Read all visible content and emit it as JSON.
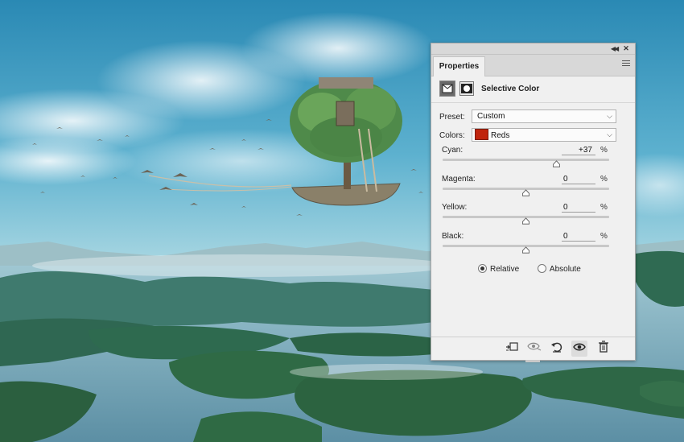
{
  "panel": {
    "tab_label": "Properties",
    "collapse_icon": "double-chevron-icon",
    "close_icon": "close-icon",
    "menu_icon": "hamburger-menu-icon",
    "adjustment_title": "Selective Color",
    "preset": {
      "label": "Preset:",
      "value": "Custom"
    },
    "colors": {
      "label": "Colors:",
      "value": "Reds",
      "swatch_color": "#c0240d"
    },
    "sliders": [
      {
        "label": "Cyan:",
        "value": "+37",
        "unit": "%",
        "level": 37
      },
      {
        "label": "Magenta:",
        "value": "0",
        "unit": "%",
        "level": 0
      },
      {
        "label": "Yellow:",
        "value": "0",
        "unit": "%",
        "level": 0
      },
      {
        "label": "Black:",
        "value": "0",
        "unit": "%",
        "level": 0
      }
    ],
    "method": {
      "options": [
        "Relative",
        "Absolute"
      ],
      "selected": "Relative"
    },
    "footer_icons": [
      "clip-to-layer-icon",
      "view-previous-icon",
      "reset-icon",
      "visibility-eye-icon",
      "trash-icon"
    ]
  },
  "colors": {
    "sky_top": "#2b8fb8",
    "sky_mid": "#7ec3d8",
    "panel_bg": "#f0f0f0"
  }
}
